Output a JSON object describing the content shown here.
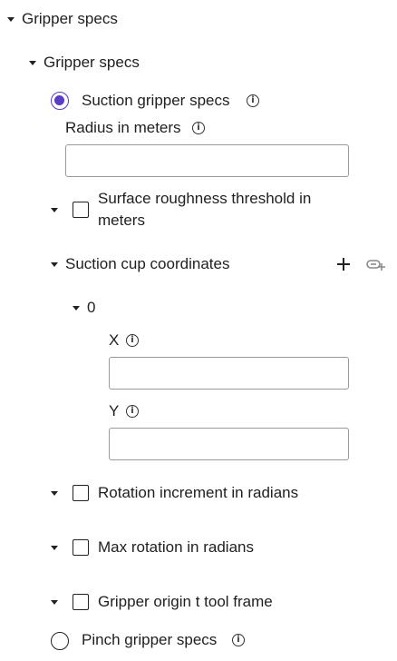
{
  "tree": {
    "root_label": "Gripper specs",
    "child_label": "Gripper specs",
    "suction": {
      "label": "Suction gripper specs",
      "radius_label": "Radius in meters",
      "radius_value": "",
      "roughness_label": "Surface roughness threshold in meters",
      "coordinates_label": "Suction cup coordinates",
      "add_icon": "plus-icon",
      "link_icon": "link-add-icon",
      "item_index": "0",
      "x_label": "X",
      "x_value": "",
      "y_label": "Y",
      "y_value": "",
      "rotation_increment_label": "Rotation increment in radians",
      "max_rotation_label": "Max rotation in radians",
      "origin_label": "Gripper origin t tool frame"
    },
    "pinch": {
      "label": "Pinch gripper specs"
    }
  },
  "colors": {
    "accent": "#5b3cc4",
    "border": "#9a9a9a",
    "text": "#1f1f1f"
  }
}
